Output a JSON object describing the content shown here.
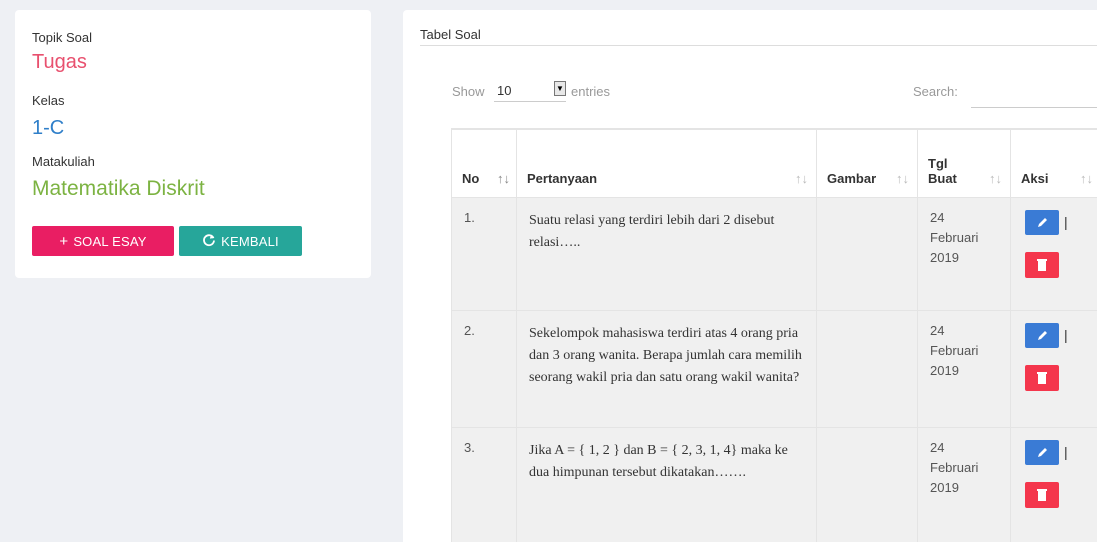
{
  "info": {
    "topik_label": "Topik Soal",
    "topik_value": "Tugas",
    "kelas_label": "Kelas",
    "kelas_value": "1-C",
    "matkul_label": "Matakuliah",
    "matkul_value": "Matematika Diskrit"
  },
  "buttons": {
    "soal_esay": "SOAL ESAY",
    "soal_esay_icon": "plus-icon",
    "kembali": "KEMBALI",
    "kembali_icon": "refresh-icon"
  },
  "table_card": {
    "title": "Tabel Soal",
    "show_label": "Show",
    "show_value": "10",
    "entries_label": "entries",
    "search_label": "Search:",
    "search_value": ""
  },
  "table": {
    "headers": [
      "No",
      "Pertanyaan",
      "Gambar",
      "Tgl Buat",
      "Aksi"
    ],
    "header_tgl_line1": "Tgl",
    "header_tgl_line2": "Buat",
    "rows": [
      {
        "no": "1.",
        "pertanyaan": "Suatu relasi yang terdiri lebih dari 2 disebut relasi…..",
        "gambar": "",
        "tgl1": "24",
        "tgl2": "Februari",
        "tgl3": "2019"
      },
      {
        "no": "2.",
        "pertanyaan": "Sekelompok mahasiswa terdiri atas 4 orang pria dan 3 orang wanita. Berapa jumlah cara memilih seorang wakil pria dan satu orang wakil wanita?",
        "gambar": "",
        "tgl1": "24",
        "tgl2": "Februari",
        "tgl3": "2019"
      },
      {
        "no": "3.",
        "pertanyaan": "Jika A = { 1, 2 } dan B = { 2, 3, 1, 4} maka ke dua himpunan tersebut dikatakan…….",
        "gambar": "",
        "tgl1": "24",
        "tgl2": "Februari",
        "tgl3": "2019"
      }
    ],
    "action_separator": "|"
  },
  "colors": {
    "topik": "#e8506e",
    "kelas": "#2f7fc9",
    "matkul": "#7cb342",
    "btn_soal": "#e91e63",
    "btn_kembali": "#26a69a",
    "edit": "#3a7bd5",
    "delete": "#f4364c"
  }
}
